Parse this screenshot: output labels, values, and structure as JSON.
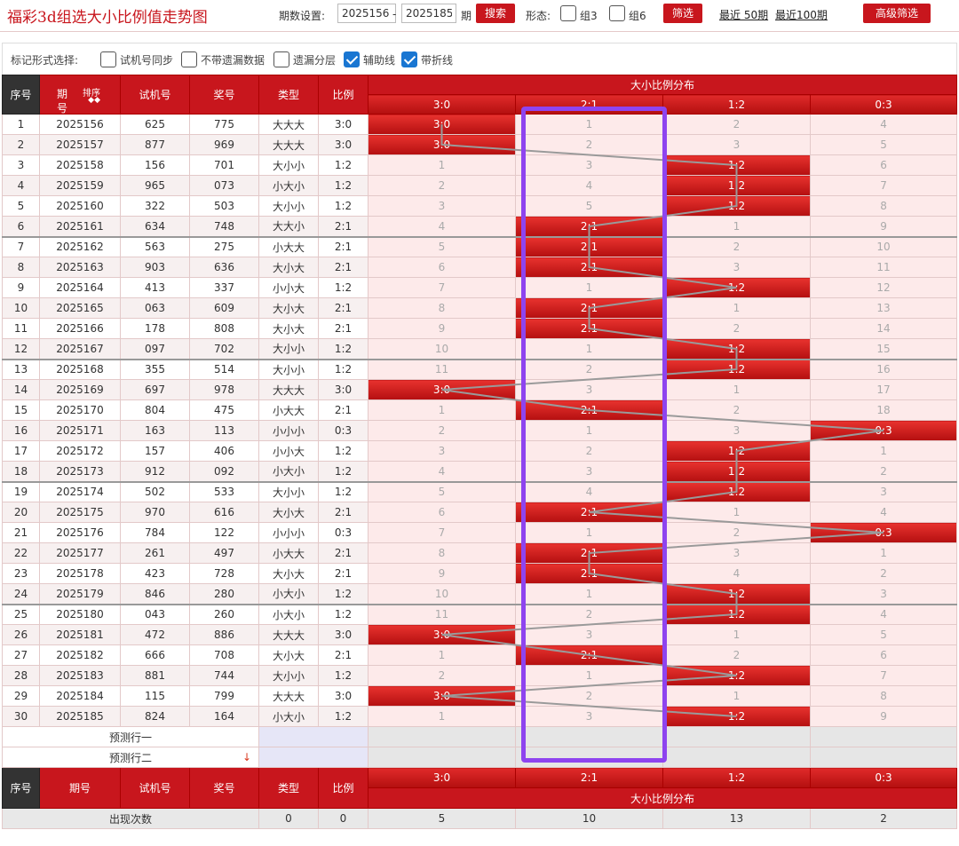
{
  "header": {
    "title": "福彩3d组选大小比例值走势图",
    "period_label": "期数设置:",
    "period_from": "2025156",
    "period_sep": "-",
    "period_to": "2025185",
    "period_unit": "期",
    "search_btn": "搜索",
    "shape_label": "形态:",
    "group3": "组3",
    "group6": "组6",
    "filter_btn": "筛选",
    "recent50": "最近 50期",
    "recent100": "最近100期",
    "advanced_btn": "高级筛选"
  },
  "mark_options": {
    "label": "标记形式选择:",
    "opts": [
      {
        "label": "试机号同步",
        "checked": false
      },
      {
        "label": "不带遗漏数据",
        "checked": false
      },
      {
        "label": "遗漏分层",
        "checked": false
      },
      {
        "label": "辅助线",
        "checked": true
      },
      {
        "label": "带折线",
        "checked": true
      }
    ]
  },
  "table": {
    "headers": {
      "seq": "序号",
      "issue": "期号",
      "sort": "排序",
      "trial": "试机号",
      "prize": "奖号",
      "type": "类型",
      "ratio": "比例",
      "dist": "大小比例分布"
    },
    "ratio_cols": [
      "3:0",
      "2:1",
      "1:2",
      "0:3"
    ],
    "rows": [
      {
        "seq": "1",
        "issue": "2025156",
        "trial": "625",
        "prize": "775",
        "type": "大大大",
        "ratio": "3:0",
        "cells": [
          "3:0",
          "1",
          "2",
          "4"
        ],
        "hit": 0
      },
      {
        "seq": "2",
        "issue": "2025157",
        "trial": "877",
        "prize": "969",
        "type": "大大大",
        "ratio": "3:0",
        "cells": [
          "3:0",
          "2",
          "3",
          "5"
        ],
        "hit": 0
      },
      {
        "seq": "3",
        "issue": "2025158",
        "trial": "156",
        "prize": "701",
        "type": "大小小",
        "ratio": "1:2",
        "cells": [
          "1",
          "3",
          "1:2",
          "6"
        ],
        "hit": 2
      },
      {
        "seq": "4",
        "issue": "2025159",
        "trial": "965",
        "prize": "073",
        "type": "小大小",
        "ratio": "1:2",
        "cells": [
          "2",
          "4",
          "1:2",
          "7"
        ],
        "hit": 2
      },
      {
        "seq": "5",
        "issue": "2025160",
        "trial": "322",
        "prize": "503",
        "type": "大小小",
        "ratio": "1:2",
        "cells": [
          "3",
          "5",
          "1:2",
          "8"
        ],
        "hit": 2
      },
      {
        "seq": "6",
        "issue": "2025161",
        "trial": "634",
        "prize": "748",
        "type": "大大小",
        "ratio": "2:1",
        "cells": [
          "4",
          "2:1",
          "1",
          "9"
        ],
        "hit": 1
      },
      {
        "seq": "7",
        "issue": "2025162",
        "trial": "563",
        "prize": "275",
        "type": "小大大",
        "ratio": "2:1",
        "cells": [
          "5",
          "2:1",
          "2",
          "10"
        ],
        "hit": 1
      },
      {
        "seq": "8",
        "issue": "2025163",
        "trial": "903",
        "prize": "636",
        "type": "大小大",
        "ratio": "2:1",
        "cells": [
          "6",
          "2:1",
          "3",
          "11"
        ],
        "hit": 1
      },
      {
        "seq": "9",
        "issue": "2025164",
        "trial": "413",
        "prize": "337",
        "type": "小小大",
        "ratio": "1:2",
        "cells": [
          "7",
          "1",
          "1:2",
          "12"
        ],
        "hit": 2
      },
      {
        "seq": "10",
        "issue": "2025165",
        "trial": "063",
        "prize": "609",
        "type": "大小大",
        "ratio": "2:1",
        "cells": [
          "8",
          "2:1",
          "1",
          "13"
        ],
        "hit": 1
      },
      {
        "seq": "11",
        "issue": "2025166",
        "trial": "178",
        "prize": "808",
        "type": "大小大",
        "ratio": "2:1",
        "cells": [
          "9",
          "2:1",
          "2",
          "14"
        ],
        "hit": 1
      },
      {
        "seq": "12",
        "issue": "2025167",
        "trial": "097",
        "prize": "702",
        "type": "大小小",
        "ratio": "1:2",
        "cells": [
          "10",
          "1",
          "1:2",
          "15"
        ],
        "hit": 2
      },
      {
        "seq": "13",
        "issue": "2025168",
        "trial": "355",
        "prize": "514",
        "type": "大小小",
        "ratio": "1:2",
        "cells": [
          "11",
          "2",
          "1:2",
          "16"
        ],
        "hit": 2
      },
      {
        "seq": "14",
        "issue": "2025169",
        "trial": "697",
        "prize": "978",
        "type": "大大大",
        "ratio": "3:0",
        "cells": [
          "3:0",
          "3",
          "1",
          "17"
        ],
        "hit": 0
      },
      {
        "seq": "15",
        "issue": "2025170",
        "trial": "804",
        "prize": "475",
        "type": "小大大",
        "ratio": "2:1",
        "cells": [
          "1",
          "2:1",
          "2",
          "18"
        ],
        "hit": 1
      },
      {
        "seq": "16",
        "issue": "2025171",
        "trial": "163",
        "prize": "113",
        "type": "小小小",
        "ratio": "0:3",
        "cells": [
          "2",
          "1",
          "3",
          "0:3"
        ],
        "hit": 3
      },
      {
        "seq": "17",
        "issue": "2025172",
        "trial": "157",
        "prize": "406",
        "type": "小小大",
        "ratio": "1:2",
        "cells": [
          "3",
          "2",
          "1:2",
          "1"
        ],
        "hit": 2
      },
      {
        "seq": "18",
        "issue": "2025173",
        "trial": "912",
        "prize": "092",
        "type": "小大小",
        "ratio": "1:2",
        "cells": [
          "4",
          "3",
          "1:2",
          "2"
        ],
        "hit": 2
      },
      {
        "seq": "19",
        "issue": "2025174",
        "trial": "502",
        "prize": "533",
        "type": "大小小",
        "ratio": "1:2",
        "cells": [
          "5",
          "4",
          "1:2",
          "3"
        ],
        "hit": 2
      },
      {
        "seq": "20",
        "issue": "2025175",
        "trial": "970",
        "prize": "616",
        "type": "大小大",
        "ratio": "2:1",
        "cells": [
          "6",
          "2:1",
          "1",
          "4"
        ],
        "hit": 1
      },
      {
        "seq": "21",
        "issue": "2025176",
        "trial": "784",
        "prize": "122",
        "type": "小小小",
        "ratio": "0:3",
        "cells": [
          "7",
          "1",
          "2",
          "0:3"
        ],
        "hit": 3
      },
      {
        "seq": "22",
        "issue": "2025177",
        "trial": "261",
        "prize": "497",
        "type": "小大大",
        "ratio": "2:1",
        "cells": [
          "8",
          "2:1",
          "3",
          "1"
        ],
        "hit": 1
      },
      {
        "seq": "23",
        "issue": "2025178",
        "trial": "423",
        "prize": "728",
        "type": "大小大",
        "ratio": "2:1",
        "cells": [
          "9",
          "2:1",
          "4",
          "2"
        ],
        "hit": 1
      },
      {
        "seq": "24",
        "issue": "2025179",
        "trial": "846",
        "prize": "280",
        "type": "小大小",
        "ratio": "1:2",
        "cells": [
          "10",
          "1",
          "1:2",
          "3"
        ],
        "hit": 2
      },
      {
        "seq": "25",
        "issue": "2025180",
        "trial": "043",
        "prize": "260",
        "type": "小大小",
        "ratio": "1:2",
        "cells": [
          "11",
          "2",
          "1:2",
          "4"
        ],
        "hit": 2
      },
      {
        "seq": "26",
        "issue": "2025181",
        "trial": "472",
        "prize": "886",
        "type": "大大大",
        "ratio": "3:0",
        "cells": [
          "3:0",
          "3",
          "1",
          "5"
        ],
        "hit": 0
      },
      {
        "seq": "27",
        "issue": "2025182",
        "trial": "666",
        "prize": "708",
        "type": "大小大",
        "ratio": "2:1",
        "cells": [
          "1",
          "2:1",
          "2",
          "6"
        ],
        "hit": 1
      },
      {
        "seq": "28",
        "issue": "2025183",
        "trial": "881",
        "prize": "744",
        "type": "大小小",
        "ratio": "1:2",
        "cells": [
          "2",
          "1",
          "1:2",
          "7"
        ],
        "hit": 2
      },
      {
        "seq": "29",
        "issue": "2025184",
        "trial": "115",
        "prize": "799",
        "type": "大大大",
        "ratio": "3:0",
        "cells": [
          "3:0",
          "2",
          "1",
          "8"
        ],
        "hit": 0
      },
      {
        "seq": "30",
        "issue": "2025185",
        "trial": "824",
        "prize": "164",
        "type": "小大小",
        "ratio": "1:2",
        "cells": [
          "1",
          "3",
          "1:2",
          "9"
        ],
        "hit": 2
      }
    ],
    "predict1": "预测行一",
    "predict2": "预测行二",
    "predict_arrow": "↓",
    "stats_label": "出现次数",
    "stats": [
      "0",
      "0",
      "5",
      "10",
      "13",
      "2"
    ]
  },
  "colors": {
    "accent": "#c8161d",
    "highlight_box": "#8e44ef"
  }
}
